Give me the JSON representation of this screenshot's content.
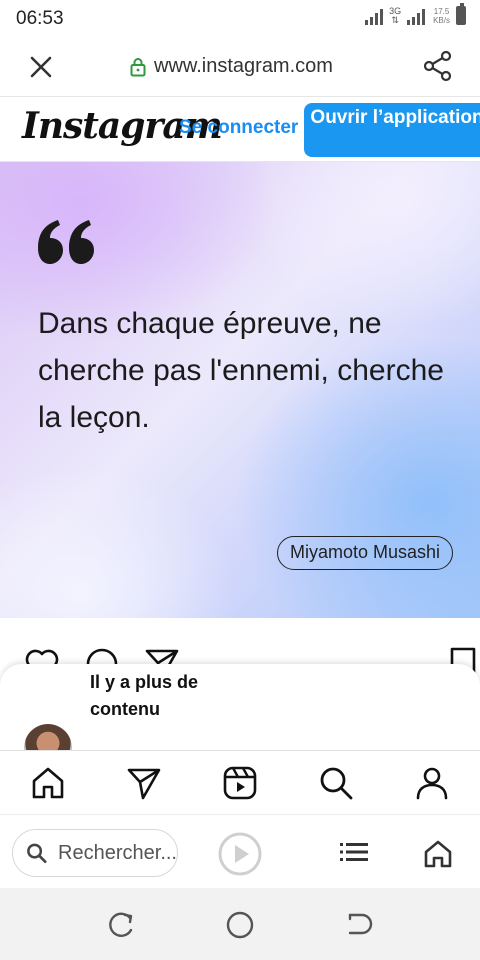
{
  "status_bar": {
    "time": "06:53",
    "network_label": "3G",
    "speed_value": "17.5",
    "speed_unit": "KB/s"
  },
  "address_bar": {
    "url": "www.instagram.com",
    "close_icon": "close-icon",
    "lock_icon": "lock-icon",
    "share_icon": "share-icon"
  },
  "ig_header": {
    "logo": "Instagram",
    "login_label": "Se connecter",
    "open_app_label": "Ouvrir l’application",
    "accent": "#1a97f0"
  },
  "post": {
    "quote_icon": "quote-icon",
    "quote_text": "Dans chaque épreuve, ne cherche pas l'ennemi, cherche la leçon.",
    "author": "Miyamoto Musashi"
  },
  "post_actions": {
    "icons": [
      "heart-icon",
      "comment-icon",
      "send-icon",
      "bookmark-icon"
    ]
  },
  "sheet": {
    "text": "Il y a plus de contenu"
  },
  "ig_nav": {
    "icons": [
      "home-icon",
      "send-icon",
      "reels-icon",
      "search-icon",
      "profile-icon"
    ]
  },
  "browser_toolbar": {
    "search_placeholder": "Rechercher...",
    "icons": [
      "search-icon",
      "play-icon",
      "tabs-list-icon",
      "home-icon"
    ]
  },
  "android_nav": {
    "icons": [
      "recent-apps-icon",
      "home-circle-icon",
      "back-icon"
    ]
  }
}
